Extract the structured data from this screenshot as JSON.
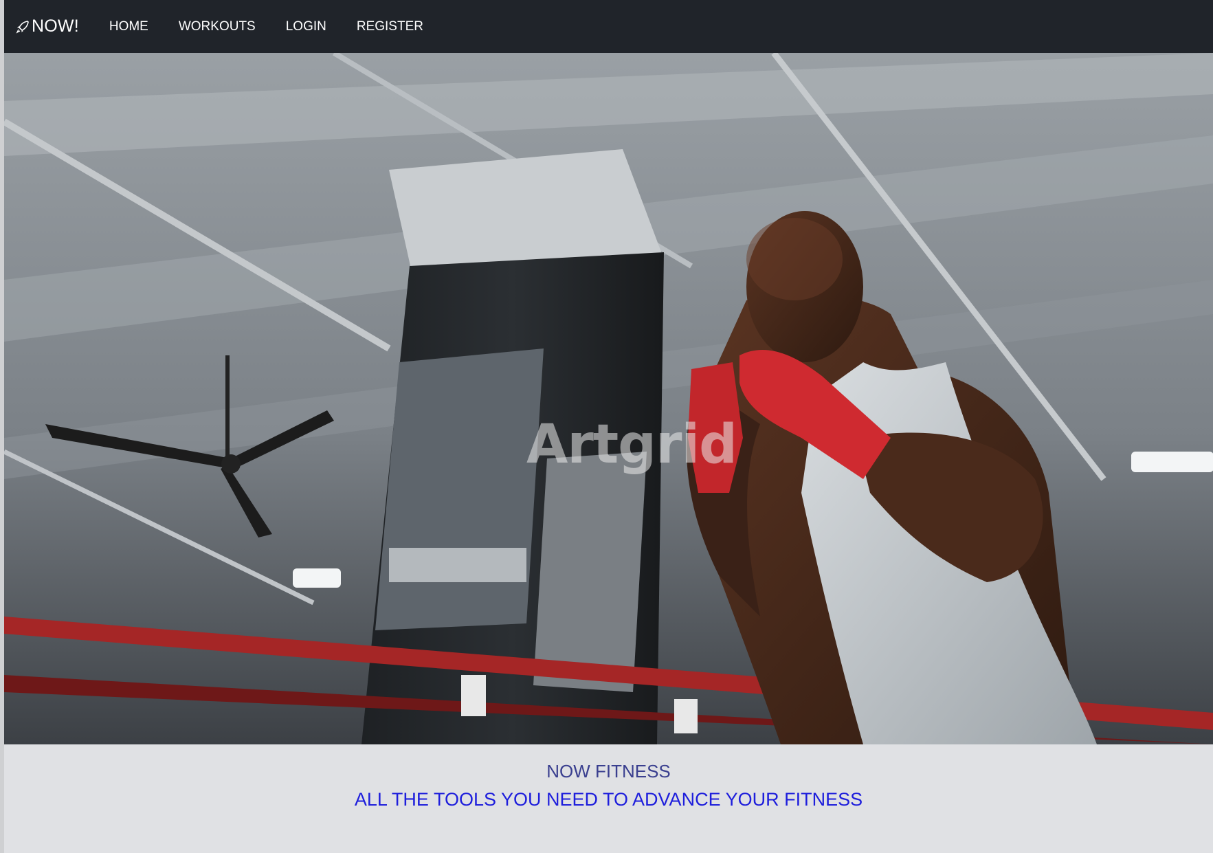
{
  "navbar": {
    "brand_icon": "rocket-icon",
    "brand_label": "NOW!",
    "links": [
      {
        "label": "HOME"
      },
      {
        "label": "WORKOUTS"
      },
      {
        "label": "LOGIN"
      },
      {
        "label": "REGISTER"
      }
    ]
  },
  "hero": {
    "watermark": "Artgrid"
  },
  "tagline": {
    "title": "NOW FITNESS",
    "subtitle": "ALL THE TOOLS YOU NEED TO ADVANCE YOUR FITNESS"
  },
  "colors": {
    "navbar_bg": "#20242a",
    "tagline_bg": "#e0e1e4",
    "title_color": "#3a3f8f",
    "subtitle_color": "#1e1edc"
  }
}
